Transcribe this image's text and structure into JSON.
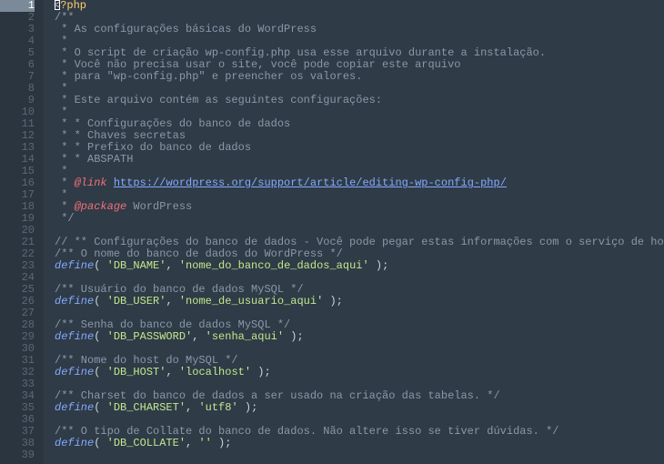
{
  "gutter": {
    "start": 1,
    "end": 39,
    "active": 1
  },
  "lines": [
    {
      "tokens": [
        {
          "t": "<",
          "c": "white"
        },
        {
          "t": "?php",
          "c": "tag"
        }
      ],
      "cursor": true
    },
    {
      "tokens": [
        {
          "t": "/**",
          "c": "comment"
        }
      ]
    },
    {
      "tokens": [
        {
          "t": " * As configurações básicas do WordPress",
          "c": "comment"
        }
      ]
    },
    {
      "tokens": [
        {
          "t": " *",
          "c": "comment"
        }
      ]
    },
    {
      "tokens": [
        {
          "t": " * O script de criação wp-config.php usa esse arquivo durante a instalação.",
          "c": "comment"
        }
      ]
    },
    {
      "tokens": [
        {
          "t": " * Você não precisa usar o site, você pode copiar este arquivo",
          "c": "comment"
        }
      ]
    },
    {
      "tokens": [
        {
          "t": " * para \"wp-config.php\" e preencher os valores.",
          "c": "comment"
        }
      ]
    },
    {
      "tokens": [
        {
          "t": " *",
          "c": "comment"
        }
      ]
    },
    {
      "tokens": [
        {
          "t": " * Este arquivo contém as seguintes configurações:",
          "c": "comment"
        }
      ]
    },
    {
      "tokens": [
        {
          "t": " *",
          "c": "comment"
        }
      ]
    },
    {
      "tokens": [
        {
          "t": " * * Configurações do banco de dados",
          "c": "comment"
        }
      ]
    },
    {
      "tokens": [
        {
          "t": " * * Chaves secretas",
          "c": "comment"
        }
      ]
    },
    {
      "tokens": [
        {
          "t": " * * Prefixo do banco de dados",
          "c": "comment"
        }
      ]
    },
    {
      "tokens": [
        {
          "t": " * * ABSPATH",
          "c": "comment"
        }
      ]
    },
    {
      "tokens": [
        {
          "t": " *",
          "c": "comment"
        }
      ]
    },
    {
      "tokens": [
        {
          "t": " * ",
          "c": "comment"
        },
        {
          "t": "@link",
          "c": "doctag"
        },
        {
          "t": " ",
          "c": "comment"
        },
        {
          "t": "https://wordpress.org/support/article/editing-wp-config-php/",
          "c": "link"
        }
      ]
    },
    {
      "tokens": [
        {
          "t": " *",
          "c": "comment"
        }
      ]
    },
    {
      "tokens": [
        {
          "t": " * ",
          "c": "comment"
        },
        {
          "t": "@package",
          "c": "doctag"
        },
        {
          "t": " WordPress",
          "c": "comment"
        }
      ]
    },
    {
      "tokens": [
        {
          "t": " */",
          "c": "comment"
        }
      ]
    },
    {
      "tokens": []
    },
    {
      "tokens": [
        {
          "t": "// ** Configurações do banco de dados - Você pode pegar estas informações com o serviço de hospedagem ** //",
          "c": "comment"
        }
      ]
    },
    {
      "tokens": [
        {
          "t": "/** O nome do banco de dados do WordPress */",
          "c": "comment"
        }
      ]
    },
    {
      "tokens": [
        {
          "t": "define",
          "c": "func"
        },
        {
          "t": "( ",
          "c": "white"
        },
        {
          "t": "'DB_NAME'",
          "c": "string"
        },
        {
          "t": ", ",
          "c": "white"
        },
        {
          "t": "'nome_do_banco_de_dados_aqui'",
          "c": "string"
        },
        {
          "t": " );",
          "c": "white"
        }
      ]
    },
    {
      "tokens": []
    },
    {
      "tokens": [
        {
          "t": "/** Usuário do banco de dados MySQL */",
          "c": "comment"
        }
      ]
    },
    {
      "tokens": [
        {
          "t": "define",
          "c": "func"
        },
        {
          "t": "( ",
          "c": "white"
        },
        {
          "t": "'DB_USER'",
          "c": "string"
        },
        {
          "t": ", ",
          "c": "white"
        },
        {
          "t": "'nome_de_usuario_aqui'",
          "c": "string"
        },
        {
          "t": " );",
          "c": "white"
        }
      ]
    },
    {
      "tokens": []
    },
    {
      "tokens": [
        {
          "t": "/** Senha do banco de dados MySQL */",
          "c": "comment"
        }
      ]
    },
    {
      "tokens": [
        {
          "t": "define",
          "c": "func"
        },
        {
          "t": "( ",
          "c": "white"
        },
        {
          "t": "'DB_PASSWORD'",
          "c": "string"
        },
        {
          "t": ", ",
          "c": "white"
        },
        {
          "t": "'senha_aqui'",
          "c": "string"
        },
        {
          "t": " );",
          "c": "white"
        }
      ]
    },
    {
      "tokens": []
    },
    {
      "tokens": [
        {
          "t": "/** Nome do host do MySQL */",
          "c": "comment"
        }
      ]
    },
    {
      "tokens": [
        {
          "t": "define",
          "c": "func"
        },
        {
          "t": "( ",
          "c": "white"
        },
        {
          "t": "'DB_HOST'",
          "c": "string"
        },
        {
          "t": ", ",
          "c": "white"
        },
        {
          "t": "'localhost'",
          "c": "string"
        },
        {
          "t": " );",
          "c": "white"
        }
      ]
    },
    {
      "tokens": []
    },
    {
      "tokens": [
        {
          "t": "/** Charset do banco de dados a ser usado na criação das tabelas. */",
          "c": "comment"
        }
      ]
    },
    {
      "tokens": [
        {
          "t": "define",
          "c": "func"
        },
        {
          "t": "( ",
          "c": "white"
        },
        {
          "t": "'DB_CHARSET'",
          "c": "string"
        },
        {
          "t": ", ",
          "c": "white"
        },
        {
          "t": "'utf8'",
          "c": "string"
        },
        {
          "t": " );",
          "c": "white"
        }
      ]
    },
    {
      "tokens": []
    },
    {
      "tokens": [
        {
          "t": "/** O tipo de Collate do banco de dados. Não altere isso se tiver dúvidas. */",
          "c": "comment"
        }
      ]
    },
    {
      "tokens": [
        {
          "t": "define",
          "c": "func"
        },
        {
          "t": "( ",
          "c": "white"
        },
        {
          "t": "'DB_COLLATE'",
          "c": "string"
        },
        {
          "t": ", ",
          "c": "white"
        },
        {
          "t": "''",
          "c": "string"
        },
        {
          "t": " );",
          "c": "white"
        }
      ]
    },
    {
      "tokens": []
    }
  ]
}
